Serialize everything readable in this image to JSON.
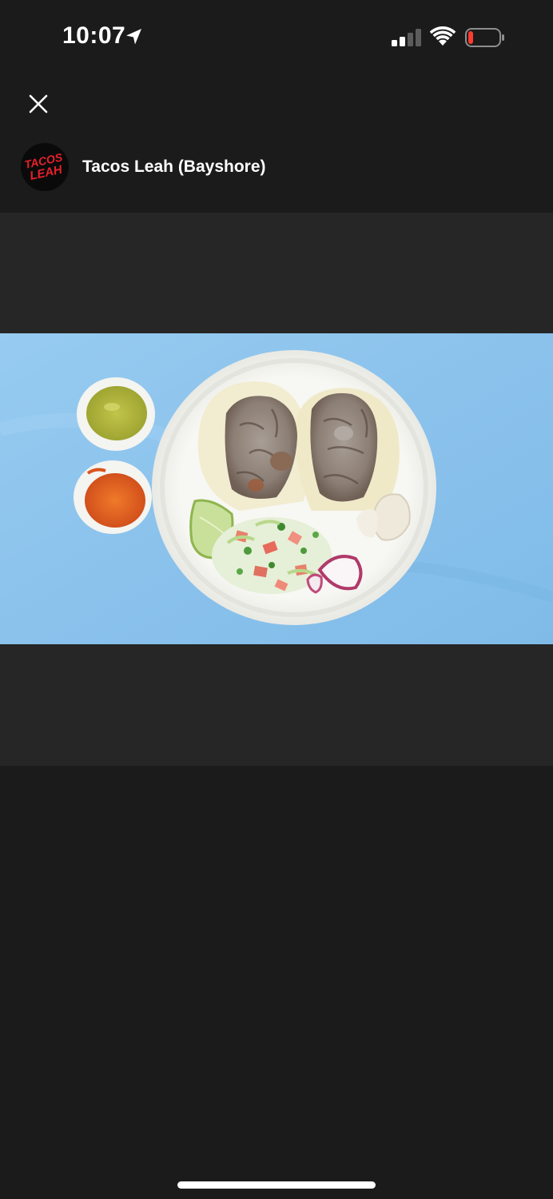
{
  "status_bar": {
    "time": "10:07",
    "icons": [
      "location-arrow-icon",
      "cellular-signal-icon",
      "wifi-icon",
      "battery-icon"
    ],
    "battery_level": 0.1,
    "battery_color": "#ff3b30"
  },
  "header": {
    "close_icon": "close-icon",
    "store_name": "Tacos Leah (Bayshore)",
    "logo_text_line1": "TACOS",
    "logo_text_line2": "LEAH",
    "logo_color": "#e8202a"
  },
  "viewer": {
    "background_color": "#262626",
    "photo_background_color": "#8ec4ec"
  },
  "colors": {
    "page_background": "#1b1b1b",
    "text": "#ffffff"
  }
}
